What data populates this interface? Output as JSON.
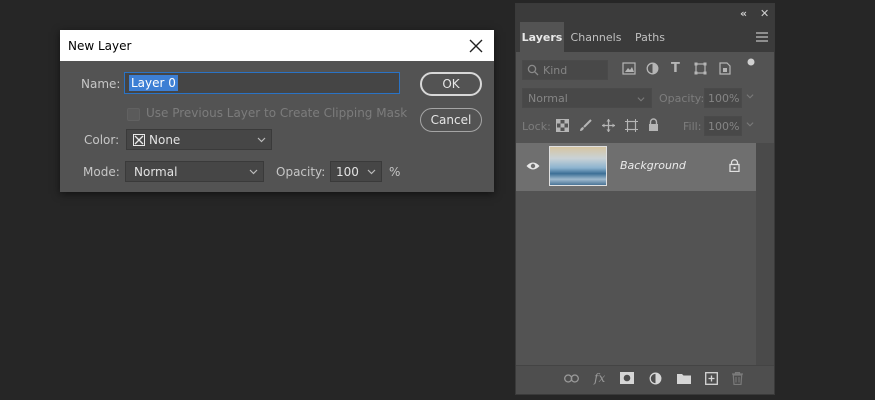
{
  "dialog": {
    "title": "New Layer",
    "name_label": "Name:",
    "name_value": "Layer 0",
    "clipping_label": "Use Previous Layer to Create Clipping Mask",
    "color_label": "Color:",
    "color_value": "None",
    "mode_label": "Mode:",
    "mode_value": "Normal",
    "opacity_label": "Opacity:",
    "opacity_value": "100",
    "opacity_unit": "%",
    "ok_label": "OK",
    "cancel_label": "Cancel"
  },
  "panel": {
    "tabs": [
      {
        "label": "Layers",
        "active": true
      },
      {
        "label": "Channels",
        "active": false
      },
      {
        "label": "Paths",
        "active": false
      }
    ],
    "kind_placeholder": "Kind",
    "blend_mode": "Normal",
    "opacity_label": "Opacity:",
    "opacity_value": "100%",
    "lock_label": "Lock:",
    "fill_label": "Fill:",
    "fill_value": "100%",
    "layers": [
      {
        "name": "Background",
        "visible": true,
        "locked": true
      }
    ],
    "collapse_glyph": "«",
    "close_glyph": "✕",
    "fx_label": "fx"
  },
  "colors": {
    "background": "#262626",
    "dialog": "#535353",
    "selection": "#3d7fd4",
    "panel": "#535353",
    "selected_layer": "#6f6f6f"
  }
}
